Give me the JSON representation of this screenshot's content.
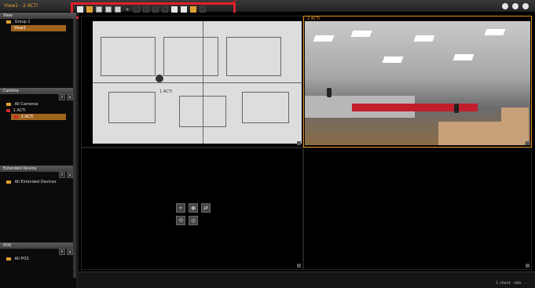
{
  "app": {
    "title": "View1 - 2 ACTi",
    "accent": "#e0a030",
    "highlight_color": "#e0202a"
  },
  "sidebar": {
    "view": {
      "header": "View",
      "group": "Group 1",
      "item": "View1"
    },
    "camera": {
      "header": "Camera",
      "all": "All Cameras",
      "items": [
        "1 ACTi",
        "2 ACTi"
      ]
    },
    "extended_device": {
      "header": "Extended Device",
      "all": "All Extended Devices"
    },
    "pos": {
      "header": "POS",
      "all": "All POS"
    }
  },
  "main": {
    "panes": [
      {
        "title": "",
        "label": "1 ACTi"
      },
      {
        "title": "2 ACTi"
      }
    ]
  },
  "statusbar": {
    "right": "1 client  · idle  ·  ·  ·"
  }
}
